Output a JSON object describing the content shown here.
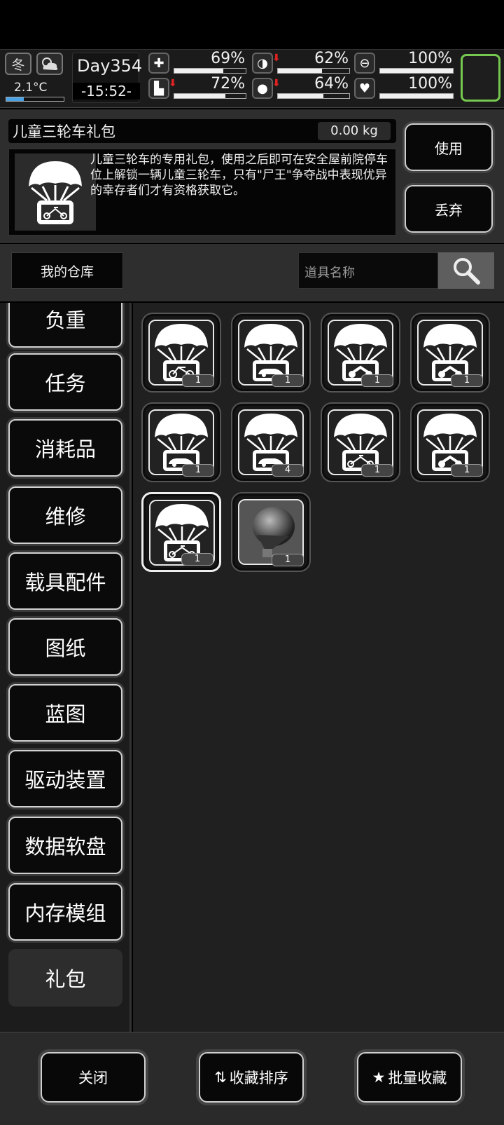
{
  "hud": {
    "season": "冬",
    "temperature": "2.1°C",
    "temperature_level": 0.3,
    "day": "Day354",
    "clock": "-15:52-",
    "stats": [
      {
        "name": "health",
        "icon": "medkit-icon",
        "value": "69%",
        "level": 0.69,
        "down": false
      },
      {
        "name": "hunger",
        "icon": "stomach-icon",
        "value": "62%",
        "level": 0.62,
        "down": true
      },
      {
        "name": "energy",
        "icon": "pill-icon",
        "value": "100%",
        "level": 1.0,
        "down": false
      },
      {
        "name": "stamina",
        "icon": "boot-icon",
        "value": "72%",
        "level": 0.72,
        "down": true
      },
      {
        "name": "thirst",
        "icon": "water-drop-icon",
        "value": "64%",
        "level": 0.64,
        "down": true
      },
      {
        "name": "mood",
        "icon": "heart-icon",
        "value": "100%",
        "level": 1.0,
        "down": false
      }
    ],
    "accent": "#76c850"
  },
  "detail": {
    "name": "儿童三轮车礼包",
    "weight": "0.00 kg",
    "description": "儿童三轮车的专用礼包，使用之后即可在安全屋前院停车位上解锁一辆儿童三轮车，只有\"尸王\"争夺战中表现优异的幸存者们才有资格获取它。",
    "use_label": "使用",
    "drop_label": "丢弃"
  },
  "toolbar": {
    "warehouse": "我的仓库",
    "search_placeholder": "道具名称"
  },
  "categories": [
    "负重",
    "任务",
    "消耗品",
    "维修",
    "载具配件",
    "图纸",
    "蓝图",
    "驱动装置",
    "数据软盘",
    "内存模组",
    "礼包"
  ],
  "active_category": "礼包",
  "items": [
    {
      "icon": "parachute-bicycle-icon",
      "count": "1"
    },
    {
      "icon": "parachute-car-icon",
      "count": "1"
    },
    {
      "icon": "parachute-motorcycle-icon",
      "count": "1"
    },
    {
      "icon": "parachute-motorcycle-icon",
      "count": "1"
    },
    {
      "icon": "parachute-car-icon",
      "count": "1"
    },
    {
      "icon": "parachute-car-icon",
      "count": "4"
    },
    {
      "icon": "parachute-tricycle-icon",
      "count": "1"
    },
    {
      "icon": "parachute-motorcycle-icon",
      "count": "1"
    },
    {
      "icon": "parachute-tricycle-icon",
      "count": "1"
    },
    {
      "icon": "hot-air-balloon-icon",
      "count": "1"
    }
  ],
  "bottom": {
    "close": "关闭",
    "sort": "收藏排序",
    "batch": "批量收藏"
  }
}
